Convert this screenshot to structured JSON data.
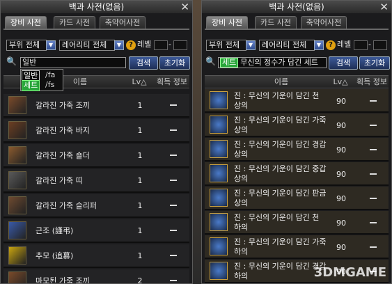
{
  "left": {
    "title": "백과 사전(없음)",
    "tabs": [
      "장비 사전",
      "카드 사전",
      "축약어사전"
    ],
    "filter_part": "부위 전체",
    "filter_rarity": "레어리티 전체",
    "level_label": "레벨",
    "search_value": "일반",
    "search_button": "검색",
    "reset_button": "초기화",
    "dropdown": [
      {
        "label": "일반",
        "shortcut": "/fa"
      },
      {
        "label": "세트",
        "shortcut": "/fs"
      }
    ],
    "columns": {
      "name": "이름",
      "lv": "Lv△",
      "info": "획득 정보"
    },
    "rows": [
      {
        "name": "갈라진 가죽 조끼",
        "lv": "1",
        "info": "—"
      },
      {
        "name": "갈라진 가죽 바지",
        "lv": "1",
        "info": "—"
      },
      {
        "name": "갈라진 가죽 숄더",
        "lv": "1",
        "info": "—"
      },
      {
        "name": "갈라진 가죽 띠",
        "lv": "1",
        "info": "—"
      },
      {
        "name": "갈라진 가죽 슬리퍼",
        "lv": "1",
        "info": "—"
      },
      {
        "name": "근조 (謹弔)",
        "lv": "1",
        "info": "—"
      },
      {
        "name": "추모 (追慕)",
        "lv": "1",
        "info": "—"
      },
      {
        "name": "마모된 가죽 조끼",
        "lv": "2",
        "info": "—"
      }
    ]
  },
  "right": {
    "title": "백과 사전(없음)",
    "tabs": [
      "장비 사전",
      "카드 사전",
      "축약어사전"
    ],
    "filter_part": "부위 전체",
    "filter_rarity": "레어리티 전체",
    "level_label": "레벨",
    "search_tag": "세트",
    "search_value": "무신의 정수가 담긴 세트",
    "search_button": "검색",
    "reset_button": "초기화",
    "columns": {
      "name": "이름",
      "lv": "Lv△",
      "info": "획득 정보"
    },
    "rows": [
      {
        "line1": "진 : 무신의 기운이 담긴 천",
        "line2": "상의",
        "lv": "90",
        "info": "—"
      },
      {
        "line1": "진 : 무신의 기운이 담긴 가죽",
        "line2": "상의",
        "lv": "90",
        "info": "—"
      },
      {
        "line1": "진 : 무신의 기운이 담긴 경갑",
        "line2": "상의",
        "lv": "90",
        "info": "—"
      },
      {
        "line1": "진 : 무신의 기운이 담긴 중갑",
        "line2": "상의",
        "lv": "90",
        "info": "—"
      },
      {
        "line1": "진 : 무신의 기운이 담긴 판금",
        "line2": "상의",
        "lv": "90",
        "info": "—"
      },
      {
        "line1": "진 : 무신의 기운이 담긴 천",
        "line2": "하의",
        "lv": "90",
        "info": "—"
      },
      {
        "line1": "진 : 무신의 기운이 담긴 가죽",
        "line2": "하의",
        "lv": "90",
        "info": "—"
      },
      {
        "line1": "진 : 무신의 기운이 담긴 경갑",
        "line2": "하의",
        "lv": "90",
        "info": "—"
      }
    ]
  },
  "icons_left": [
    "vest-icon",
    "pants-icon",
    "shoulder-icon",
    "belt-icon",
    "slipper-icon",
    "blade-icon",
    "ribbon-icon",
    "vest-icon"
  ],
  "icons_right": [
    "armor-icon",
    "armor-icon",
    "armor-icon",
    "armor-icon",
    "armor-icon",
    "armor-icon",
    "armor-icon",
    "armor-icon"
  ],
  "watermark": "3DMGAME"
}
